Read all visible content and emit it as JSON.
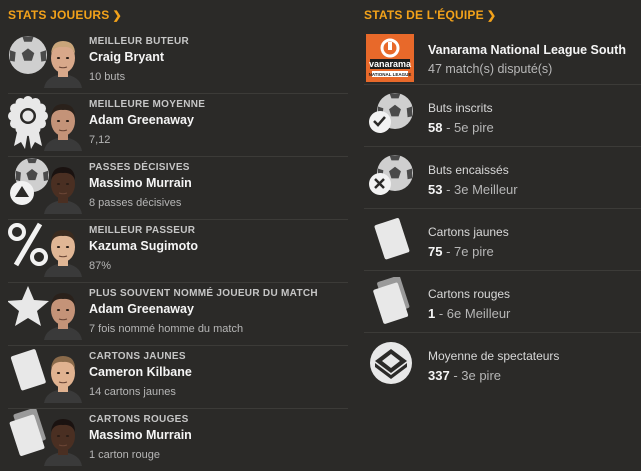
{
  "player_stats": {
    "title": "STATS JOUEURS",
    "items": [
      {
        "caption": "MEILLEUR BUTEUR",
        "name": "Craig Bryant",
        "sub": "10 buts",
        "icon": "football-icon",
        "face": {
          "skin": "#d8a88a",
          "hair": "#c9a57a"
        }
      },
      {
        "caption": "MEILLEURE MOYENNE",
        "name": "Adam Greenaway",
        "sub": "7,12",
        "icon": "rosette-icon",
        "face": {
          "skin": "#c49378",
          "hair": "#2a211b"
        }
      },
      {
        "caption": "PASSES DÉCISIVES",
        "name": "Massimo Murrain",
        "sub": "8 passes décisives",
        "icon": "assist-ball-icon",
        "face": {
          "skin": "#4a2f22",
          "hair": "#1a1210"
        }
      },
      {
        "caption": "MEILLEUR PASSEUR",
        "name": "Kazuma Sugimoto",
        "sub": "87%",
        "icon": "percent-icon",
        "face": {
          "skin": "#e0b695",
          "hair": "#3a2a1e"
        }
      },
      {
        "caption": "PLUS SOUVENT NOMMÉ JOUEUR DU MATCH",
        "name": "Adam Greenaway",
        "sub": "7 fois nommé homme du match",
        "icon": "star-icon",
        "face": {
          "skin": "#c49378",
          "hair": "#2a211b"
        }
      },
      {
        "caption": "CARTONS JAUNES",
        "name": "Cameron Kilbane",
        "sub": "14 cartons jaunes",
        "icon": "yellow-card-icon",
        "face": {
          "skin": "#e0b290",
          "hair": "#8a6a4a"
        }
      },
      {
        "caption": "CARTONS ROUGES",
        "name": "Massimo Murrain",
        "sub": "1 carton rouge",
        "icon": "red-card-icon",
        "face": {
          "skin": "#4a2f22",
          "hair": "#1a1210"
        }
      }
    ]
  },
  "team_stats": {
    "title": "STATS DE L'ÉQUIPE",
    "league": {
      "name": "Vanarama National League South",
      "sub": "47 match(s) disputé(s)",
      "logo_text_top": "vanarama",
      "logo_text_bottom": "NATIONAL LEAGUE"
    },
    "items": [
      {
        "label": "Buts inscrits",
        "value": "58",
        "rank": " - 5e pire",
        "icon": "goals-scored-icon"
      },
      {
        "label": "Buts encaissés",
        "value": "53",
        "rank": " - 3e Meilleur",
        "icon": "goals-conceded-icon"
      },
      {
        "label": "Cartons jaunes",
        "value": "75",
        "rank": " - 7e pire",
        "icon": "yellow-card-icon"
      },
      {
        "label": "Cartons rouges",
        "value": "1",
        "rank": " - 6e Meilleur",
        "icon": "red-card-icon"
      },
      {
        "label": "Moyenne de spectateurs",
        "value": "337",
        "rank": " - 3e pire",
        "icon": "stadium-icon"
      }
    ]
  },
  "colors": {
    "accent": "#f3a21a",
    "background": "#2b2a28",
    "logo": "#e8692a"
  }
}
